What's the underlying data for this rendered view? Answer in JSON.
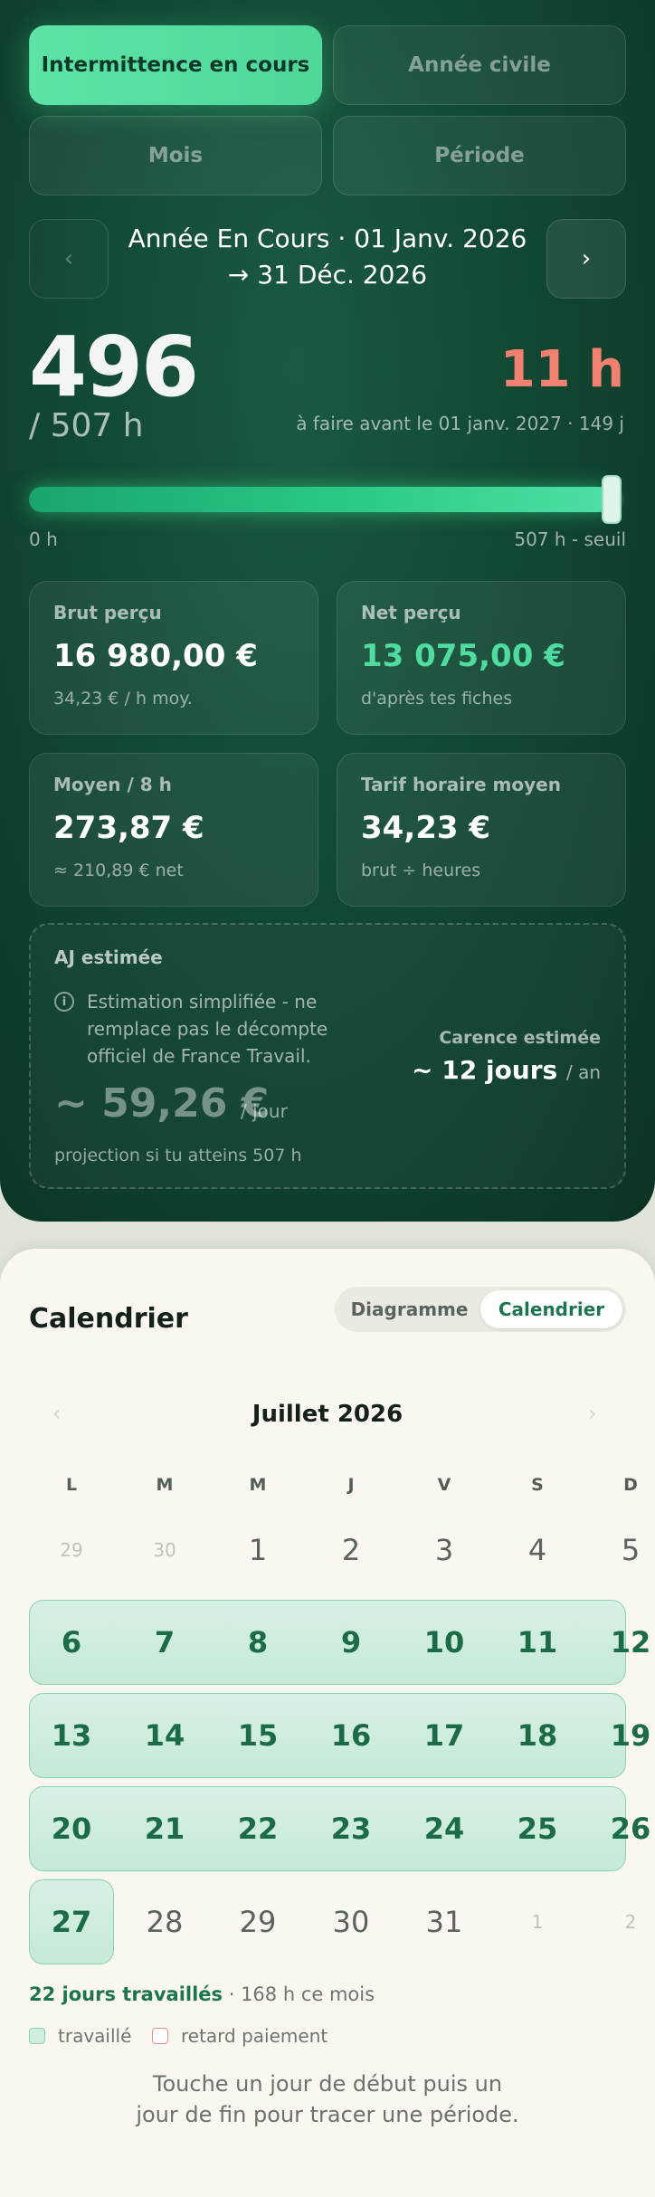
{
  "modes": {
    "intermittence": "Intermittence en cours",
    "annee_civile": "Année civile",
    "mois": "Mois",
    "periode": "Période"
  },
  "period": {
    "prev": "‹",
    "next": "›",
    "line1": "Année En Cours · 01 Janv. 2026",
    "line2": "→ 31 Déc. 2026"
  },
  "hours": {
    "done": "496",
    "target": "/ 507 h",
    "remaining": "11 h",
    "deadline": "à faire avant le 01 janv. 2027 · 149 j",
    "progress_fraction": 0.978,
    "bar_min": "0 h",
    "bar_max": "507 h - seuil"
  },
  "stats": {
    "brut": {
      "title": "Brut perçu",
      "value": "16 980,00 €",
      "sub": "34,23 € / h moy."
    },
    "net": {
      "title": "Net perçu",
      "value": "13 075,00 €",
      "sub": "d'après tes fiches"
    },
    "moyen": {
      "title": "Moyen / 8 h",
      "value": "273,87 €",
      "sub": "≈ 210,89 € net"
    },
    "tarif": {
      "title": "Tarif horaire moyen",
      "value": "34,23 €",
      "sub": "brut ÷ heures"
    }
  },
  "aj": {
    "title": "AJ estimée",
    "info_icon": "i",
    "note": "Estimation simplifiée - ne remplace pas le décompte officiel de France Travail.",
    "amount": "~ 59,26 €",
    "amount_unit": "/ jour",
    "projection": "projection si tu atteins 507 h",
    "carence_title": "Carence estimée",
    "carence_value": "~ 12 jours",
    "carence_unit": "/ an"
  },
  "calendar": {
    "title": "Calendrier",
    "view_diagram": "Diagramme",
    "view_calendar": "Calendrier",
    "month": "Juillet 2026",
    "prev": "‹",
    "next": "›",
    "weekdays": [
      "L",
      "M",
      "M",
      "J",
      "V",
      "S",
      "D"
    ],
    "weeks": [
      [
        "29",
        "30",
        "1",
        "2",
        "3",
        "4",
        "5"
      ],
      [
        "6",
        "7",
        "8",
        "9",
        "10",
        "11",
        "12"
      ],
      [
        "13",
        "14",
        "15",
        "16",
        "17",
        "18",
        "19"
      ],
      [
        "20",
        "21",
        "22",
        "23",
        "24",
        "25",
        "26"
      ],
      [
        "27",
        "28",
        "29",
        "30",
        "31",
        "1",
        "2"
      ]
    ],
    "summary_bold": "22 jours travaillés",
    "summary_rest": " · 168 h ce mois",
    "legend_worked": "travaillé",
    "legend_late": "retard paiement",
    "hint": "Touche un jour de début puis un jour de fin pour tracer une période."
  },
  "colors": {
    "accent": "#4fd79a",
    "remaining": "#f08070",
    "worked_day": "#1b6b47"
  }
}
